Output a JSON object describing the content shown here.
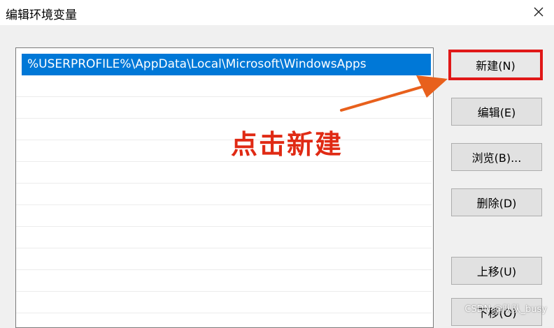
{
  "window": {
    "title": "编辑环境变量",
    "close_icon": "close-icon"
  },
  "list": {
    "items": [
      "%USERPROFILE%\\AppData\\Local\\Microsoft\\WindowsApps"
    ],
    "selected_index": 0
  },
  "buttons": {
    "new": "新建(N)",
    "edit": "编辑(E)",
    "browse": "浏览(B)...",
    "delete": "删除(D)",
    "move_up": "上移(U)",
    "move_down": "下移(O)"
  },
  "annotation": {
    "text": "点击新建",
    "arrow_icon": "arrow-icon"
  },
  "watermark": "CSDN @队队_busy",
  "colors": {
    "selection": "#0078d7",
    "highlight_border": "#e01818",
    "annotation": "#e02a14"
  }
}
